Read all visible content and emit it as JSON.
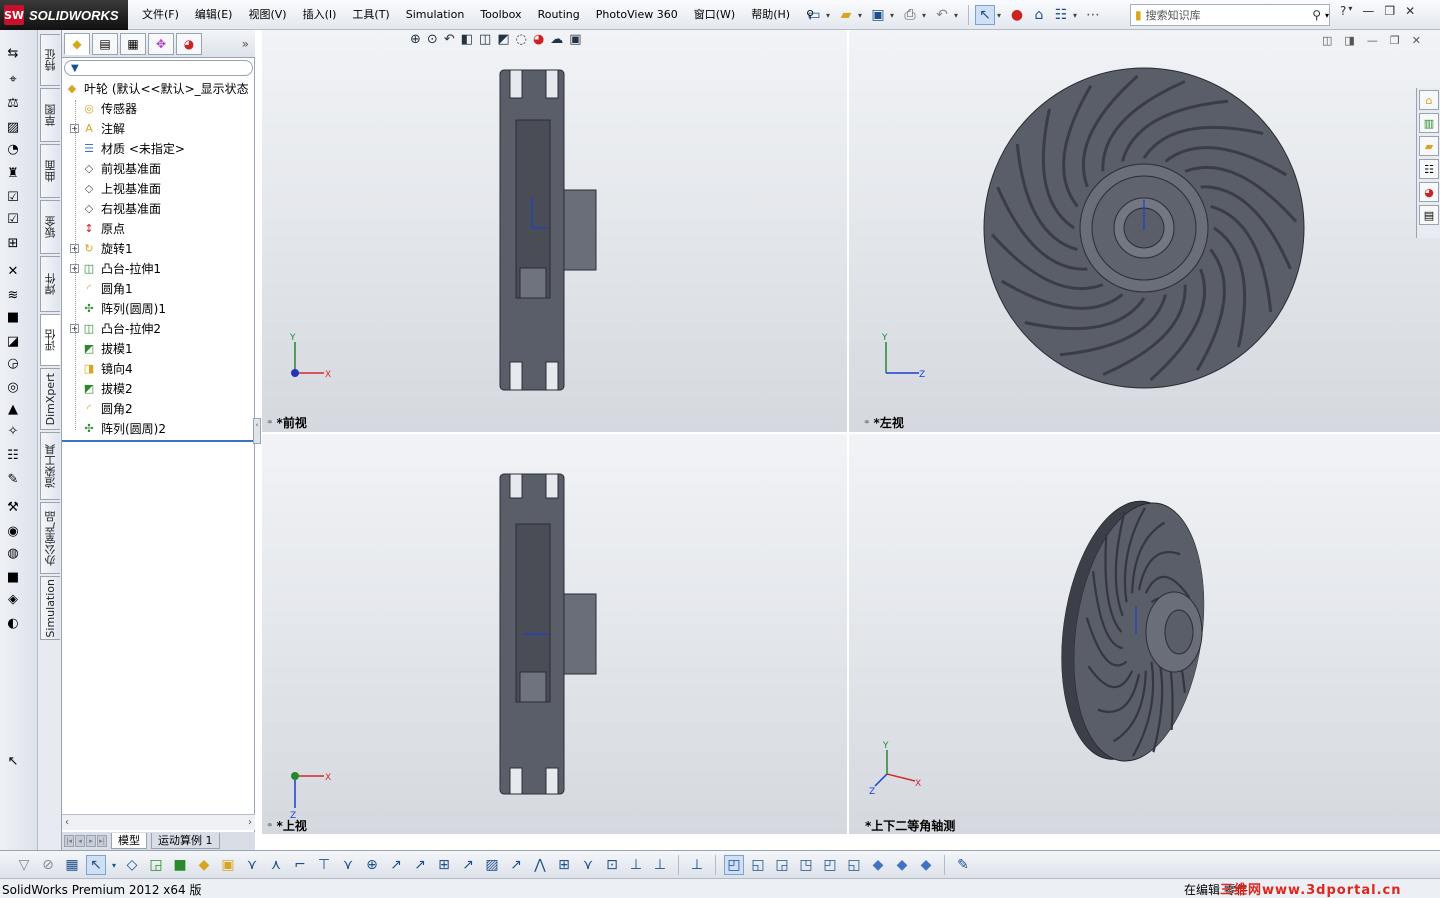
{
  "app": {
    "name": "SOLIDWORKS",
    "logo_mark": "SW"
  },
  "menu": [
    "文件(F)",
    "编辑(E)",
    "视图(V)",
    "插入(I)",
    "工具(T)",
    "Simulation",
    "Toolbox",
    "Routing",
    "PhotoView 360",
    "窗口(W)",
    "帮助(H)"
  ],
  "search": {
    "placeholder": "搜索知识库"
  },
  "side_tabs": [
    "特征",
    "草图",
    "曲面",
    "钣金",
    "焊件",
    "评估",
    "DimXpert",
    "渲染工具",
    "办公室产品",
    "Simulation"
  ],
  "tree": {
    "root": "叶轮  (默认<<默认>_显示状态",
    "nodes": [
      {
        "label": "传感器",
        "icon": "sensor-icon",
        "expandable": false
      },
      {
        "label": "注解",
        "icon": "annotation-icon",
        "expandable": true
      },
      {
        "label": "材质 <未指定>",
        "icon": "material-icon",
        "expandable": false
      },
      {
        "label": "前视基准面",
        "icon": "plane-icon",
        "expandable": false
      },
      {
        "label": "上视基准面",
        "icon": "plane-icon",
        "expandable": false
      },
      {
        "label": "右视基准面",
        "icon": "plane-icon",
        "expandable": false
      },
      {
        "label": "原点",
        "icon": "origin-icon",
        "expandable": false
      },
      {
        "label": "旋转1",
        "icon": "revolve-icon",
        "expandable": true
      },
      {
        "label": "凸台-拉伸1",
        "icon": "boss-extrude-icon",
        "expandable": true
      },
      {
        "label": "圆角1",
        "icon": "fillet-icon",
        "expandable": false
      },
      {
        "label": "阵列(圆周)1",
        "icon": "circular-pattern-icon",
        "expandable": false
      },
      {
        "label": "凸台-拉伸2",
        "icon": "boss-extrude-icon",
        "expandable": true
      },
      {
        "label": "拔模1",
        "icon": "draft-icon",
        "expandable": false
      },
      {
        "label": "镜向4",
        "icon": "mirror-icon",
        "expandable": false
      },
      {
        "label": "拔模2",
        "icon": "draft-icon",
        "expandable": false
      },
      {
        "label": "圆角2",
        "icon": "fillet-icon",
        "expandable": false
      },
      {
        "label": "阵列(圆周)2",
        "icon": "circular-pattern-icon",
        "expandable": false
      }
    ]
  },
  "bottom_tabs": [
    "模型",
    "运动算例 1"
  ],
  "viewports": {
    "front": "*前视",
    "left": "*左视",
    "top": "*上视",
    "iso": "*上下二等角轴测"
  },
  "axes": {
    "x": "X",
    "y": "Y",
    "z": "Z"
  },
  "status": {
    "left": "SolidWorks Premium 2012 x64 版",
    "right": "在编辑 零件",
    "watermark": "三维网www.3dportal.cn"
  },
  "colors": {
    "part": "#5a5e68",
    "part_dark": "#3c3f47",
    "part_light": "#7d818b",
    "viewport_bg": "#e6e9ed",
    "accent": "#3f71c4"
  }
}
